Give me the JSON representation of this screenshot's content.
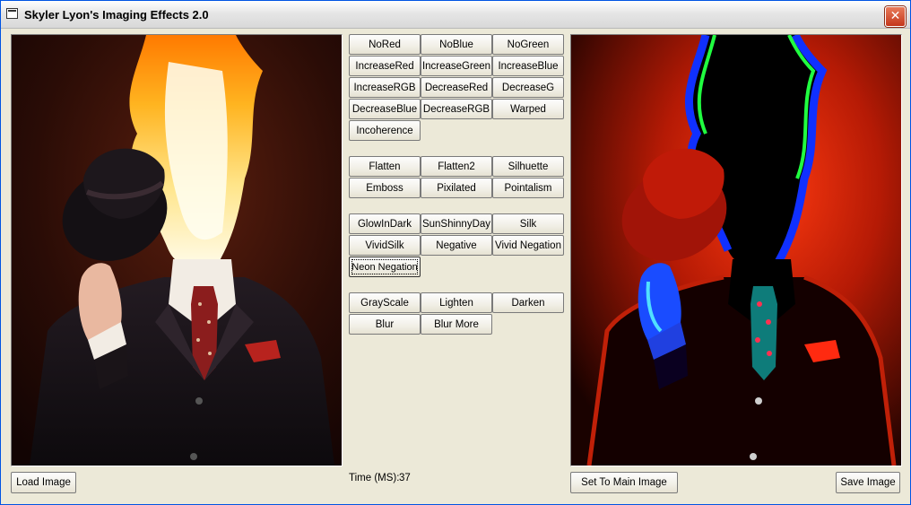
{
  "window": {
    "title": "Skyler Lyon's Imaging Effects 2.0",
    "close_glyph": "✕",
    "title_icon": "app-window-icon"
  },
  "effects": {
    "group1": [
      "NoRed",
      "NoBlue",
      "NoGreen",
      "IncreaseRed",
      "IncreaseGreen",
      "IncreaseBlue",
      "IncreaseRGB",
      "DecreaseRed",
      "DecreaseG",
      "DecreaseBlue",
      "DecreaseRGB",
      "Warped",
      "Incoherence"
    ],
    "group2": [
      "Flatten",
      "Flatten2",
      "Silhuette",
      "Emboss",
      "Pixilated",
      "Pointalism"
    ],
    "group3": [
      "GlowInDark",
      "SunShinnyDay",
      "Silk",
      "VividSilk",
      "Negative",
      "Vivid Negation",
      "Neon Negation"
    ],
    "group4": [
      "GrayScale",
      "Lighten",
      "Darken",
      "Blur",
      "Blur More"
    ]
  },
  "status": {
    "time_label": "Time (MS):",
    "time_value": "37"
  },
  "actions": {
    "load": "Load Image",
    "set_main": "Set To Main Image",
    "save": "Save Image"
  },
  "colors": {
    "face": "#ece9d8",
    "frame": "#0054e3",
    "close": "#c4371b"
  }
}
